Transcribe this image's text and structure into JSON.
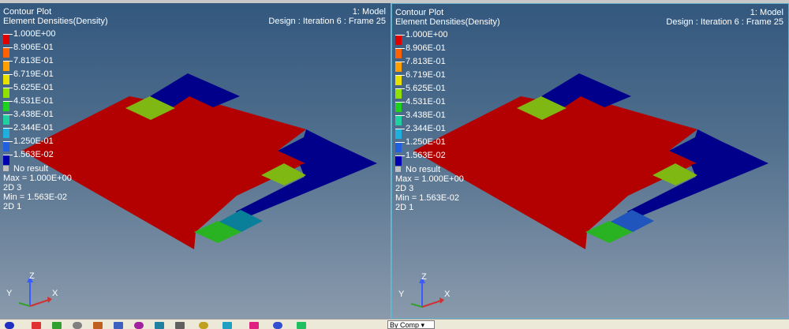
{
  "viewports": [
    {
      "plot_type": "Contour Plot",
      "result": "Element Densities(Density)",
      "model": "1: Model",
      "design": "Design : Iteration 6 : Frame 25",
      "legend": [
        {
          "label": "1.000E+00",
          "color": "#e00000"
        },
        {
          "label": "8.906E-01",
          "color": "#ff6000"
        },
        {
          "label": "7.813E-01",
          "color": "#ffa000"
        },
        {
          "label": "6.719E-01",
          "color": "#e8e000"
        },
        {
          "label": "5.625E-01",
          "color": "#90e000"
        },
        {
          "label": "4.531E-01",
          "color": "#20d020"
        },
        {
          "label": "3.438E-01",
          "color": "#20d0a0"
        },
        {
          "label": "2.344E-01",
          "color": "#20b0e0"
        },
        {
          "label": "1.250E-01",
          "color": "#2060e0"
        },
        {
          "label": "1.563E-02",
          "color": "#0000b0"
        }
      ],
      "no_result": "No result",
      "max": "Max = 1.000E+00",
      "max_elem": "2D 3",
      "min": "Min = 1.563E-02",
      "min_elem": "2D 1",
      "axis_labels": {
        "x": "X",
        "y": "Y",
        "z": "Z"
      }
    },
    {
      "plot_type": "Contour Plot",
      "result": "Element Densities(Density)",
      "model": "1: Model",
      "design": "Design : Iteration 6 : Frame 25",
      "legend": [
        {
          "label": "1.000E+00",
          "color": "#e00000"
        },
        {
          "label": "8.906E-01",
          "color": "#ff6000"
        },
        {
          "label": "7.813E-01",
          "color": "#ffa000"
        },
        {
          "label": "6.719E-01",
          "color": "#e8e000"
        },
        {
          "label": "5.625E-01",
          "color": "#90e000"
        },
        {
          "label": "4.531E-01",
          "color": "#20d020"
        },
        {
          "label": "3.438E-01",
          "color": "#20d0a0"
        },
        {
          "label": "2.344E-01",
          "color": "#20b0e0"
        },
        {
          "label": "1.250E-01",
          "color": "#2060e0"
        },
        {
          "label": "1.563E-02",
          "color": "#0000b0"
        }
      ],
      "no_result": "No result",
      "max": "Max = 1.000E+00",
      "max_elem": "2D 3",
      "min": "Min = 1.563E-02",
      "min_elem": "2D 1",
      "axis_labels": {
        "x": "X",
        "y": "Y",
        "z": "Z"
      }
    }
  ],
  "mesh_colors": {
    "red": "#b30000",
    "navy": "#00008b",
    "yellowgreen": "#7fb812",
    "green": "#29b322",
    "teal": "#0a7f9a",
    "blue": "#1f55bd"
  },
  "toolbar": {
    "select_value": "By Comp",
    "icons": [
      "contour-icon",
      "legend-icon",
      "deformed-icon",
      "vector-icon",
      "iso-icon",
      "tensor-icon",
      "animation-icon",
      "query-icon",
      "measure-icon",
      "section-icon",
      "tracking-icon",
      "color-icon",
      "display-icon",
      "visualization-icon"
    ]
  }
}
